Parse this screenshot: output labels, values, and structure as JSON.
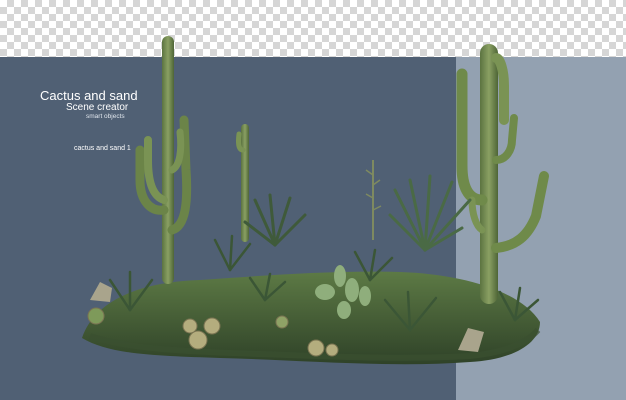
{
  "header": {
    "title": "Cactus and sand",
    "subtitle": "Scene creator",
    "tagline": "smart objects"
  },
  "labels": {
    "item_label": "cactus and sand 1"
  },
  "colors": {
    "dark_panel": "#506074",
    "light_panel": "#93a1b1",
    "cactus_green": "#6f8a4a",
    "agave_green": "#3f5a3a"
  }
}
